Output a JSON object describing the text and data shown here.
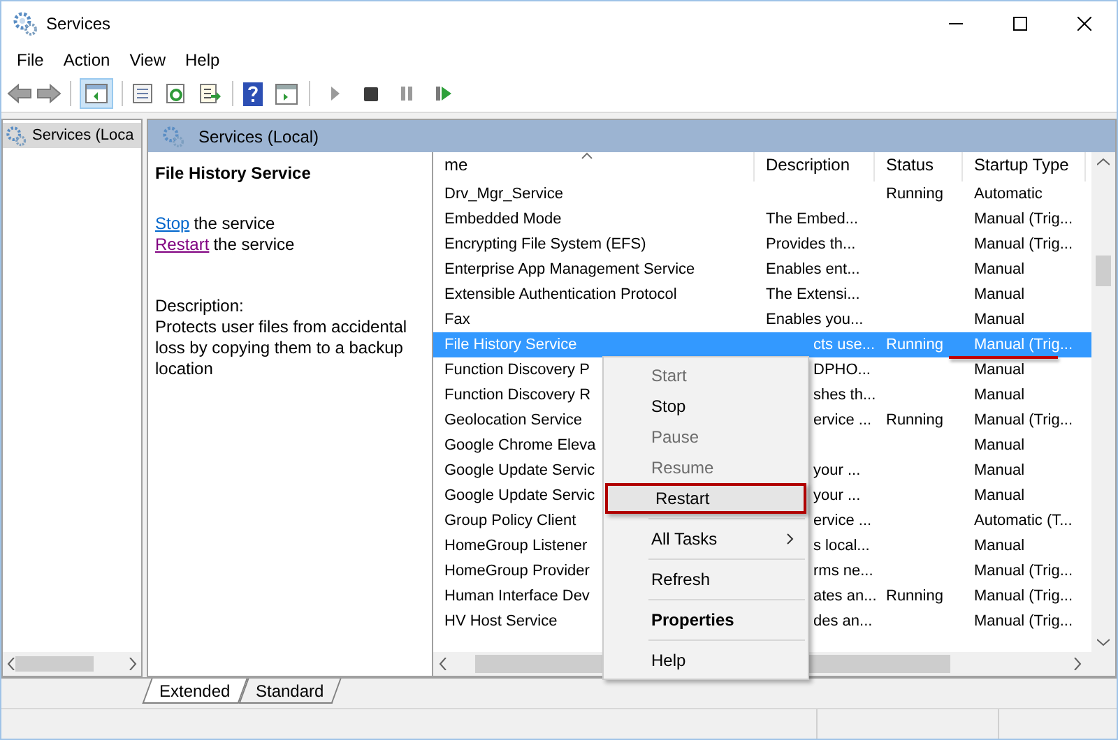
{
  "window": {
    "title": "Services"
  },
  "menu": [
    "File",
    "Action",
    "View",
    "Help"
  ],
  "toolbar": {
    "tree_toggle_pressed": true
  },
  "tree": [
    {
      "label": "Services (Loca",
      "selected": true
    }
  ],
  "header": {
    "title": "Services (Local)"
  },
  "detail": {
    "title": "File History Service",
    "actions": [
      {
        "link": "Stop",
        "text": "the service",
        "visited": false
      },
      {
        "link": "Restart",
        "text": "the service",
        "visited": true
      }
    ],
    "description_label": "Description:",
    "description": "Protects user files from accidental loss by copying them to a backup location"
  },
  "columns": [
    {
      "label": "me",
      "sorted": true
    },
    {
      "label": "Description",
      "sorted": false
    },
    {
      "label": "Status",
      "sorted": false
    },
    {
      "label": "Startup Type",
      "sorted": false
    }
  ],
  "rows": [
    {
      "kind": "plain",
      "name": "Drv_Mgr_Service",
      "status": "Running",
      "startup": "Automatic",
      "selected": false,
      "underlined": false
    },
    {
      "kind": "plain",
      "name": "Embedded Mode",
      "description": "The Embed...",
      "startup": "Manual (Trig...",
      "selected": false,
      "underlined": false
    },
    {
      "kind": "plain",
      "name": "Encrypting File System (EFS)",
      "description": "Provides th...",
      "startup": "Manual (Trig...",
      "selected": false,
      "underlined": false
    },
    {
      "kind": "plain",
      "name": "Enterprise App Management Service",
      "description": "Enables ent...",
      "startup": "Manual",
      "selected": false,
      "underlined": false
    },
    {
      "kind": "plain",
      "name": "Extensible Authentication Protocol",
      "description": "The Extensi...",
      "startup": "Manual",
      "selected": false,
      "underlined": false
    },
    {
      "kind": "plain",
      "name": "Fax",
      "description": "Enables you...",
      "startup": "Manual",
      "selected": false,
      "underlined": false
    },
    {
      "kind": "overlapped",
      "name": "File History Service",
      "description": "cts use...",
      "status": "Running",
      "startup": "Manual (Trig...",
      "selected": true,
      "underlined": true
    },
    {
      "kind": "overlapped",
      "name": "Function Discovery P",
      "description": "DPHO...",
      "startup": "Manual",
      "selected": false,
      "underlined": false
    },
    {
      "kind": "overlapped",
      "name": "Function Discovery R",
      "description": "shes th...",
      "startup": "Manual",
      "selected": false,
      "underlined": false
    },
    {
      "kind": "overlapped",
      "name": "Geolocation Service",
      "description": "ervice ...",
      "status": "Running",
      "startup": "Manual (Trig...",
      "selected": false,
      "underlined": false
    },
    {
      "kind": "overlapped",
      "name": "Google Chrome Eleva",
      "startup": "Manual",
      "selected": false,
      "underlined": false
    },
    {
      "kind": "overlapped",
      "name": "Google Update Servic",
      "description": "your ...",
      "startup": "Manual",
      "selected": false,
      "underlined": false
    },
    {
      "kind": "overlapped",
      "name": "Google Update Servic",
      "description": "your ...",
      "startup": "Manual",
      "selected": false,
      "underlined": false
    },
    {
      "kind": "overlapped",
      "name": "Group Policy Client",
      "description": "ervice ...",
      "startup": "Automatic (T...",
      "selected": false,
      "underlined": false
    },
    {
      "kind": "overlapped",
      "name": "HomeGroup Listener",
      "description": "s local...",
      "startup": "Manual",
      "selected": false,
      "underlined": false
    },
    {
      "kind": "overlapped",
      "name": "HomeGroup Provider",
      "description": "rms ne...",
      "startup": "Manual (Trig...",
      "selected": false,
      "underlined": false
    },
    {
      "kind": "overlapped",
      "name": "Human Interface Dev",
      "description": "ates an...",
      "status": "Running",
      "startup": "Manual (Trig...",
      "selected": false,
      "underlined": false
    },
    {
      "kind": "overlapped",
      "name": "HV Host Service",
      "description": "des an...",
      "startup": "Manual (Trig...",
      "selected": false,
      "underlined": false
    }
  ],
  "context_menu": [
    {
      "kind": "item",
      "label": "Start",
      "disabled": true,
      "highlighted": false
    },
    {
      "kind": "item",
      "label": "Stop",
      "disabled": false,
      "highlighted": false
    },
    {
      "kind": "item",
      "label": "Pause",
      "disabled": true,
      "highlighted": false
    },
    {
      "kind": "item",
      "label": "Resume",
      "disabled": true,
      "highlighted": false
    },
    {
      "kind": "item",
      "label": "Restart",
      "disabled": false,
      "highlighted": true
    },
    {
      "kind": "separator"
    },
    {
      "kind": "submenu",
      "label": "All Tasks",
      "disabled": false,
      "highlighted": false
    },
    {
      "kind": "separator"
    },
    {
      "kind": "item",
      "label": "Refresh",
      "disabled": false,
      "highlighted": false
    },
    {
      "kind": "separator"
    },
    {
      "kind": "default",
      "label": "Properties",
      "disabled": false,
      "highlighted": false
    },
    {
      "kind": "separator"
    },
    {
      "kind": "item",
      "label": "Help",
      "disabled": false,
      "highlighted": false
    }
  ],
  "view_tabs": [
    {
      "label": "Extended",
      "selected": true
    },
    {
      "label": "Standard",
      "selected": false
    }
  ]
}
